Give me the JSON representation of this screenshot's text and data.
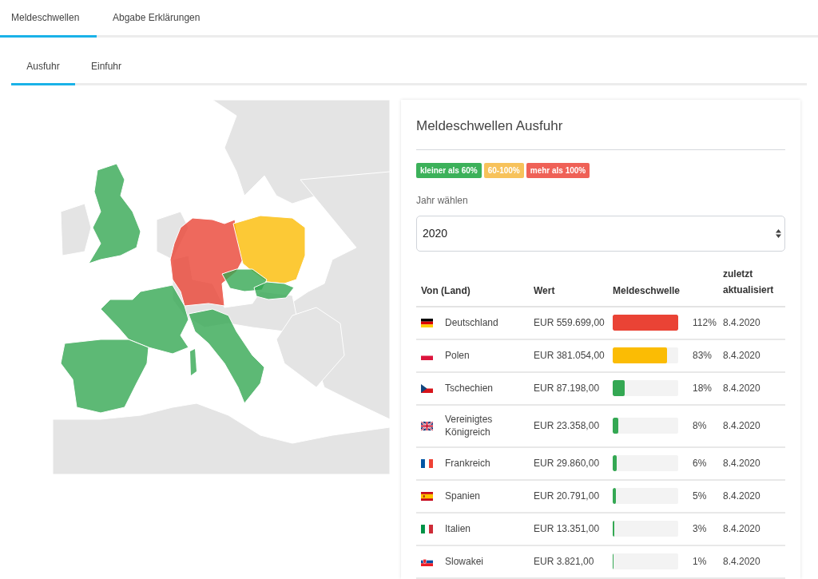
{
  "tabs": [
    {
      "label": "Meldeschwellen",
      "selected": true
    },
    {
      "label": "Abgabe Erklärungen",
      "selected": false
    }
  ],
  "subtabs": [
    {
      "label": "Ausfuhr",
      "selected": true
    },
    {
      "label": "Einfuhr",
      "selected": false
    }
  ],
  "panel": {
    "title": "Meldeschwellen Ausfuhr",
    "legend": [
      {
        "label": "kleiner als 60%",
        "color": "#3cb15a"
      },
      {
        "label": "60-100%",
        "color": "#f7c25b"
      },
      {
        "label": "mehr als 100%",
        "color": "#ef6157"
      }
    ],
    "year_label": "Jahr wählen",
    "year_value": "2020",
    "table": {
      "columns": [
        "Von (Land)",
        "Wert",
        "Meldeschwelle",
        "zuletzt aktualisiert"
      ],
      "rows": [
        {
          "country": "Deutschland",
          "value": "EUR 559.699,00",
          "level": 1,
          "percent": "112%",
          "updated": "8.4.2020",
          "color": "#ea4335"
        },
        {
          "country": "Polen",
          "value": "EUR 381.054,00",
          "level": 0.83,
          "percent": "83%",
          "updated": "8.4.2020",
          "color": "#fbbc04"
        },
        {
          "country": "Tschechien",
          "value": "EUR 87.198,00",
          "level": 0.18,
          "percent": "18%",
          "updated": "8.4.2020",
          "color": "#34a853"
        },
        {
          "country": "Vereinigtes Königreich",
          "value": "EUR 23.358,00",
          "level": 0.08,
          "percent": "8%",
          "updated": "8.4.2020",
          "color": "#34a853"
        },
        {
          "country": "Frankreich",
          "value": "EUR 29.860,00",
          "level": 0.06,
          "percent": "6%",
          "updated": "8.4.2020",
          "color": "#34a853"
        },
        {
          "country": "Spanien",
          "value": "EUR 20.791,00",
          "level": 0.05,
          "percent": "5%",
          "updated": "8.4.2020",
          "color": "#34a853"
        },
        {
          "country": "Italien",
          "value": "EUR 13.351,00",
          "level": 0.03,
          "percent": "3%",
          "updated": "8.4.2020",
          "color": "#34a853"
        },
        {
          "country": "Slowakei",
          "value": "EUR 3.821,00",
          "level": 0.01,
          "percent": "1%",
          "updated": "8.4.2020",
          "color": "#34a853"
        }
      ]
    }
  }
}
